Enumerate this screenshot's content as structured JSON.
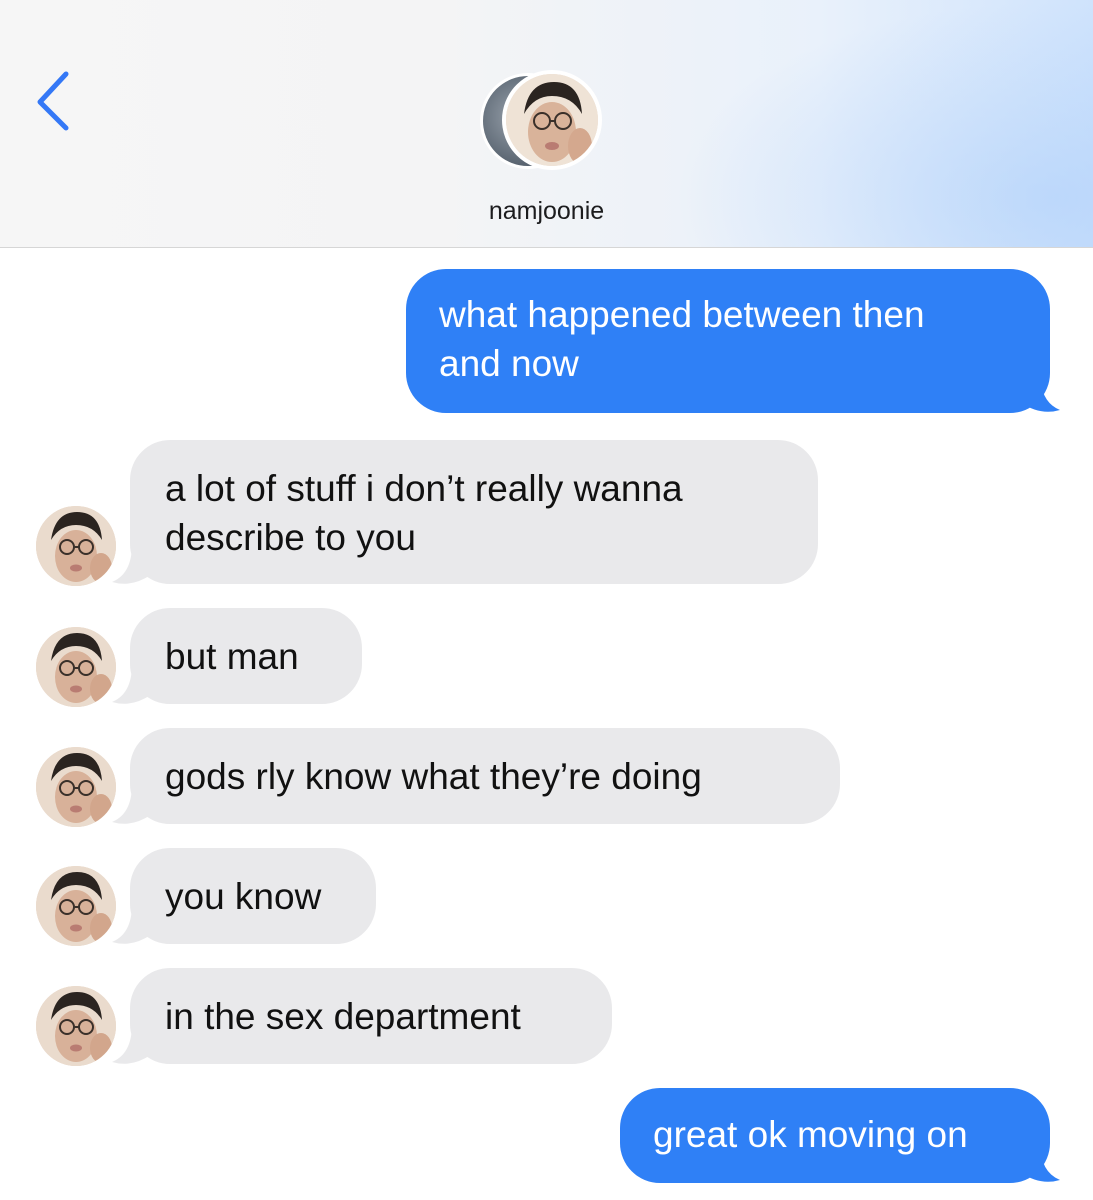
{
  "header": {
    "contact_name": "namjoonie",
    "back_icon": "chevron-left-icon",
    "accent_color": "#3478f6"
  },
  "messages": [
    {
      "side": "sent",
      "text": "what happened between then and now",
      "lines": [
        "what happened between then",
        "and now"
      ]
    },
    {
      "side": "received",
      "text": "a lot of stuff i don’t really wanna describe to you",
      "lines": [
        "a lot of stuff i don’t really wanna",
        "describe to you"
      ]
    },
    {
      "side": "received",
      "text": "but man"
    },
    {
      "side": "received",
      "text": "gods rly know what they’re doing"
    },
    {
      "side": "received",
      "text": "you know"
    },
    {
      "side": "received",
      "text": "in the sex department"
    },
    {
      "side": "sent",
      "text": "great ok moving on"
    }
  ],
  "colors": {
    "sent_bubble": "#2f80f6",
    "received_bubble": "#e9e9eb",
    "sent_text": "#ffffff",
    "received_text": "#111111"
  }
}
